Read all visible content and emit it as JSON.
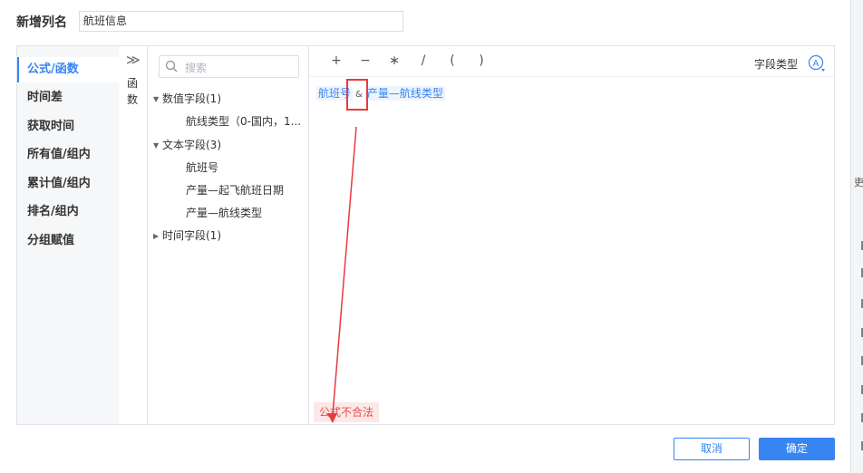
{
  "column_name": {
    "label": "新增列名",
    "value": "航班信息"
  },
  "categories": [
    {
      "label": "公式/函数",
      "active": true
    },
    {
      "label": "时间差",
      "active": false
    },
    {
      "label": "获取时间",
      "active": false
    },
    {
      "label": "所有值/组内",
      "active": false
    },
    {
      "label": "累计值/组内",
      "active": false
    },
    {
      "label": "排名/组内",
      "active": false
    },
    {
      "label": "分组赋值",
      "active": false
    }
  ],
  "function_toggle": {
    "label_line1": "函",
    "label_line2": "数"
  },
  "search": {
    "placeholder": "搜索"
  },
  "field_tree": {
    "numeric": {
      "label": "数值字段(1)",
      "items": [
        "航线类型（0-国内，1..."
      ]
    },
    "text": {
      "label": "文本字段(3)",
      "items": [
        "航班号",
        "产量—起飞航班日期",
        "产量—航线类型"
      ]
    },
    "time": {
      "label": "时间字段(1)"
    }
  },
  "operators": [
    "+",
    "−",
    "∗",
    "/",
    "(",
    ")"
  ],
  "field_type_label": "字段类型",
  "formula": {
    "token1": "航班号",
    "amp": "&",
    "token2": "产量—航线类型"
  },
  "error_message": "公式不合法",
  "buttons": {
    "cancel": "取消",
    "ok": "确定"
  },
  "right_edge_glyph": "吏",
  "colors": {
    "accent": "#3685f2",
    "error": "#e64a4a",
    "annotation": "#e8393d"
  }
}
